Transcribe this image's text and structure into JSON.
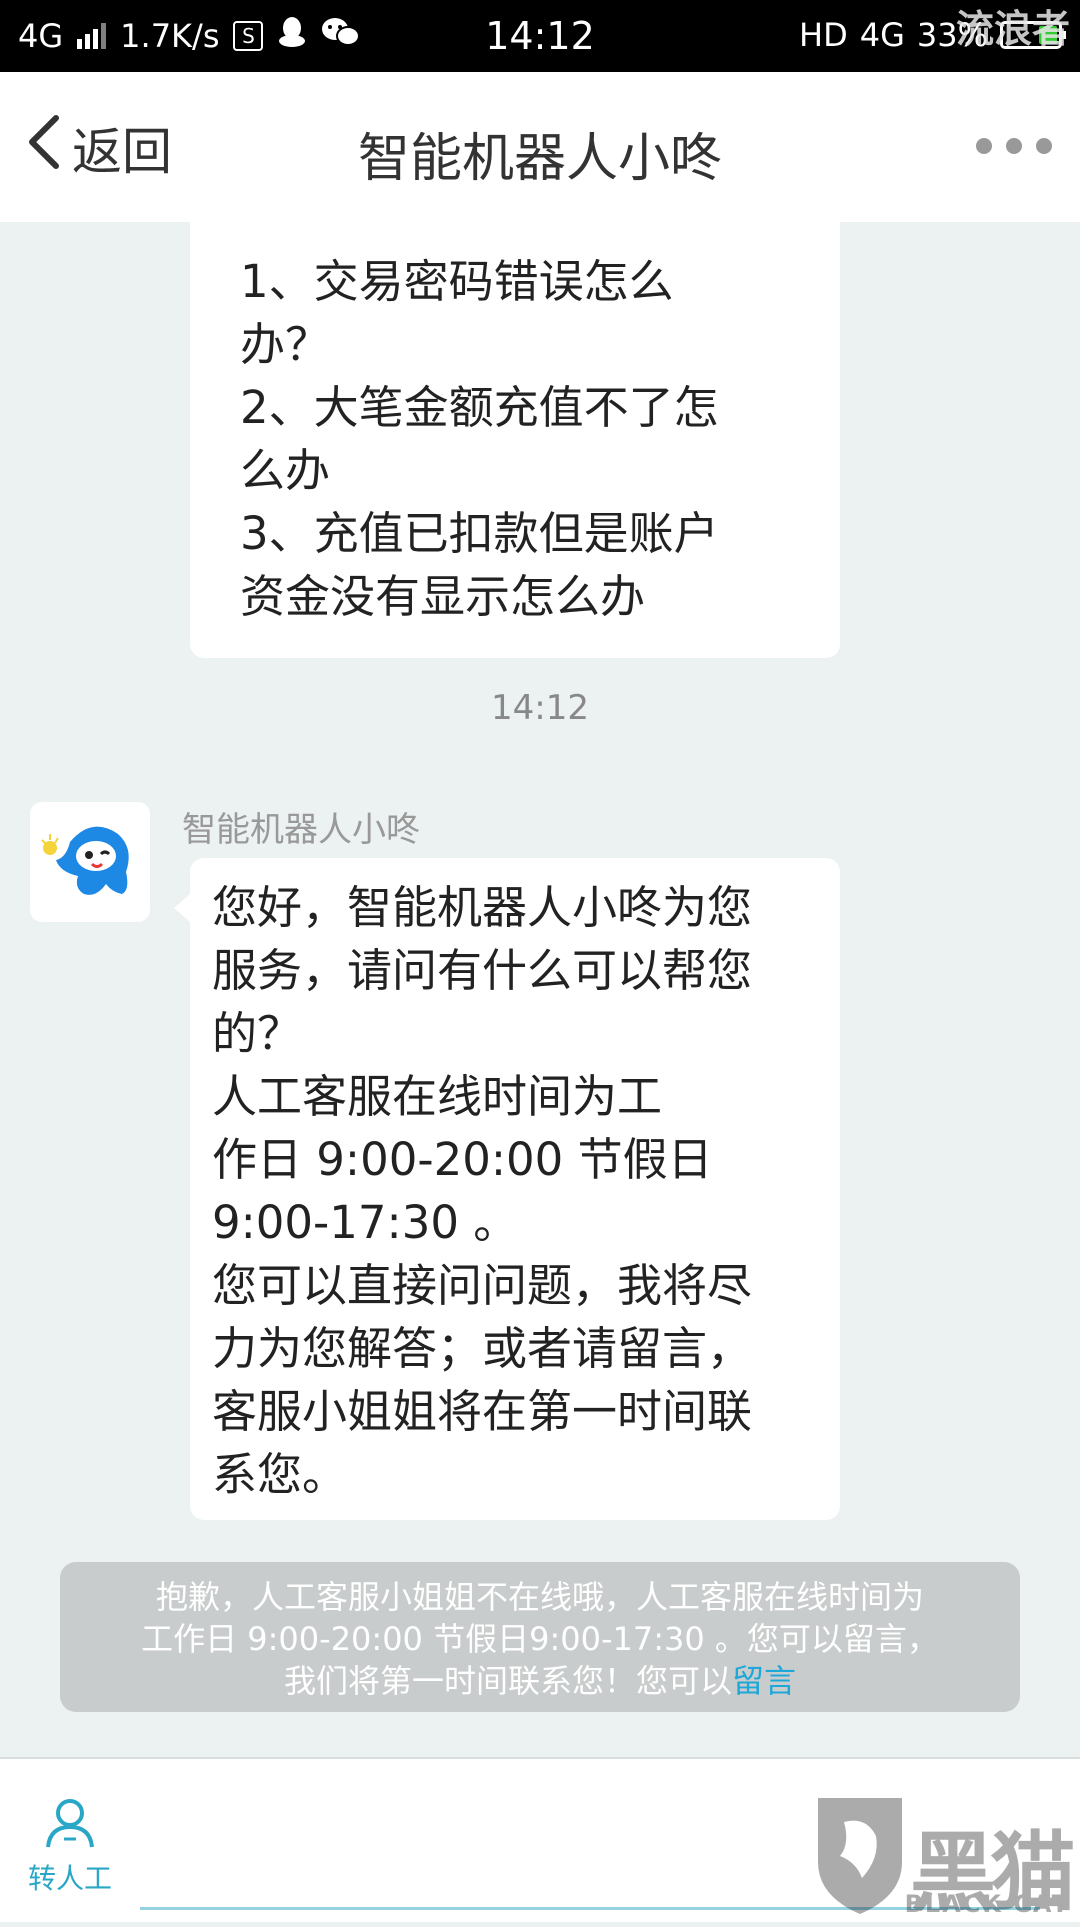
{
  "status_bar": {
    "network": "4G",
    "speed": "1.7K/s",
    "sim_icon": "S",
    "time": "14:12",
    "hd": "HD",
    "network_right": "4G",
    "battery": "33%",
    "battery_level": 0.33,
    "watermark": "流浪者",
    "icons": [
      "signal-icon",
      "sim-icon",
      "qq-icon",
      "wechat-icon",
      "battery-icon"
    ]
  },
  "nav": {
    "back_label": "返回",
    "title": "智能机器人小咚"
  },
  "chat": {
    "top_bubble": {
      "lines": [
        "1、交易密码错误怎么\n办？",
        "2、大笔金额充值不了怎\n么办",
        "3、充值已扣款但是账户\n资金没有显示怎么办"
      ]
    },
    "timestamp": "14:12",
    "sender_name": "智能机器人小咚",
    "main_bubble": {
      "text": "您好，智能机器人小咚为您\n服务，请问有什么可以帮您\n的？\n人工客服在线时间为工\n作日 9:00-20:00 节假日\n9:00-17:30 。\n您可以直接问问题，我将尽\n力为您解答；或者请留言，\n客服小姐姐将在第一时间联\n系您。"
    },
    "system_note": {
      "line1": "抱歉，人工客服小姐姐不在线哦，人工客服在线时间为",
      "line2": "工作日 9:00-20:00 节假日9:00-17:30 。您可以留言，",
      "line3": "我们将第一时间联系您！您可以",
      "link": "留言"
    }
  },
  "bottom": {
    "transfer_label": "转人工",
    "watermark_cn": "黑猫",
    "watermark_en": "BLACK CAT"
  },
  "colors": {
    "accent": "#2aa7c6",
    "link": "#1ea7d9",
    "chat_bg": "#ecf1f1",
    "system_note_bg": "#c9cccc"
  }
}
